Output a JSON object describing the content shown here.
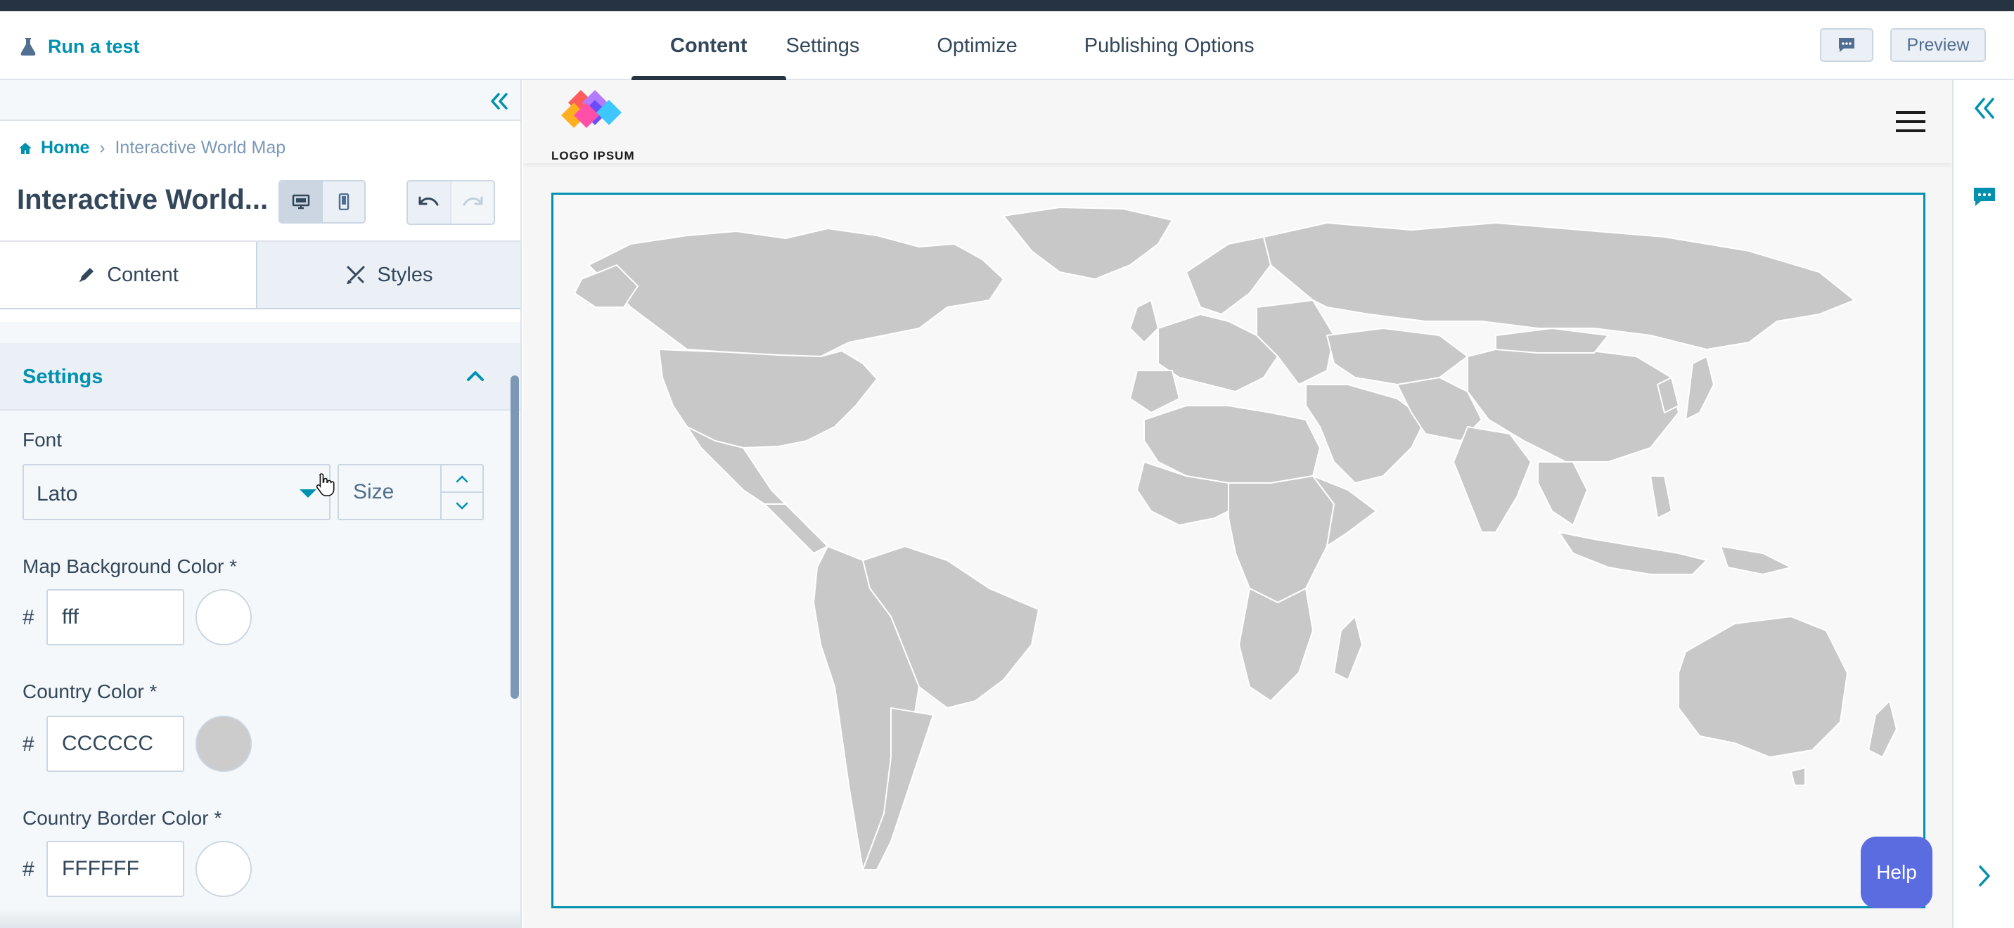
{
  "header": {
    "run_test_label": "Run a test",
    "tabs": [
      {
        "label": "Content",
        "active": true
      },
      {
        "label": "Settings",
        "active": false
      },
      {
        "label": "Optimize",
        "active": false
      },
      {
        "label": "Publishing Options",
        "active": false
      }
    ],
    "preview_label": "Preview"
  },
  "sidebar": {
    "breadcrumb": {
      "home": "Home",
      "current": "Interactive World Map"
    },
    "page_title": "Interactive World...",
    "content_tabs": [
      {
        "label": "Content",
        "icon": "pencil-icon",
        "active": true
      },
      {
        "label": "Styles",
        "icon": "brush-icon",
        "active": false
      }
    ],
    "settings_section": {
      "title": "Settings",
      "expanded": true,
      "font": {
        "label": "Font",
        "value": "Lato",
        "size_placeholder": "Size"
      },
      "map_background_color": {
        "label": "Map Background Color *",
        "hash": "#",
        "value": "fff",
        "swatch": "#ffffff"
      },
      "country_color": {
        "label": "Country Color *",
        "hash": "#",
        "value": "CCCCCC",
        "swatch": "#cccccc"
      },
      "country_border_color": {
        "label": "Country Border Color *",
        "hash": "#",
        "value": "FFFFFF",
        "swatch": "#ffffff"
      }
    }
  },
  "preview": {
    "logo_text": "LOGO IPSUM",
    "help_label": "Help"
  },
  "colors": {
    "accent": "#0091ae",
    "text": "#33475b",
    "map_country": "#c8c8c8",
    "help_button": "#5b6ce0"
  }
}
